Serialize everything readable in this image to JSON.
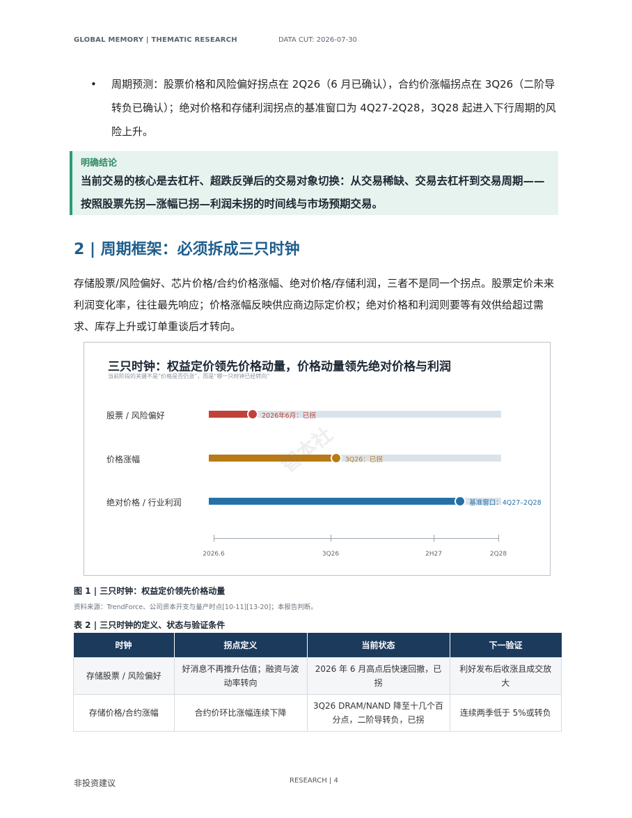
{
  "header": {
    "left": "GLOBAL MEMORY  |  THEMATIC RESEARCH",
    "right": "DATA CUT: 2026-07-30"
  },
  "bullet": {
    "symbol": "•",
    "text": "周期预测：股票价格和风险偏好拐点在 2Q26（6 月已确认），合约价涨幅拐点在 3Q26（二阶导转负已确认）；绝对价格和存储利润拐点的基准窗口为 4Q27-2Q28，3Q28 起进入下行周期的风险上升。"
  },
  "callout": {
    "label": "明确结论",
    "body": "当前交易的核心是去杠杆、超跌反弹后的交易对象切换：从交易稀缺、交易去杠杆到交易周期——按照股票先拐—涨幅已拐—利润未拐的时间线与市场预期交易。"
  },
  "section": {
    "title": "2 | 周期框架：必须拆成三只时钟",
    "paragraph": "存储股票/风险偏好、芯片价格/合约价格涨幅、绝对价格/存储利润，三者不是同一个拐点。股票定价未来利润变化率，往往最先响应；价格涨幅反映供应商边际定价权；绝对价格和利润则要等有效供给超过需求、库存上升或订单重谈后才转向。"
  },
  "chart_data": {
    "type": "bar",
    "title": "三只时钟：权益定价领先价格动量，价格动量领先绝对价格与利润",
    "subtitle": "当前阶段的关键不是“价格是否仍涨”，而是“哪一只时钟已经转向”",
    "x_ticks": [
      "2026.6",
      "3Q26",
      "2H27",
      "2Q28"
    ],
    "series": [
      {
        "name": "股票 / 风险偏好",
        "value": 0.15,
        "note": "2026年6月：已拐",
        "color": "#c0413a"
      },
      {
        "name": "价格涨幅",
        "value": 0.435,
        "note": "3Q26：已拐",
        "color": "#b87a16"
      },
      {
        "name": "绝对价格 / 行业利润",
        "value": 0.86,
        "note": "基准窗口：4Q27–2Q28",
        "color": "#2670a8"
      }
    ],
    "track_color": "#dbe3ea"
  },
  "watermark": "智本社",
  "figure": {
    "caption": "图 1 | 三只时钟：权益定价领先价格动量",
    "source": "资料来源：TrendForce、公司资本开支与量产时点[10-11][13-20]；本报告判断。"
  },
  "table": {
    "title": "表 2 | 三只时钟的定义、状态与验证条件",
    "headers": [
      "时钟",
      "拐点定义",
      "当前状态",
      "下一验证"
    ],
    "rows": [
      [
        "存储股票 / 风险偏好",
        "好消息不再推升估值；融资与波动率转向",
        "2026 年 6 月高点后快速回撤，已拐",
        "利好发布后收涨且成交放大"
      ],
      [
        "存储价格/合约涨幅",
        "合约价环比涨幅连续下降",
        "3Q26 DRAM/NAND 降至十几个百分点，二阶导转负，已拐",
        "连续两季低于 5%或转负"
      ]
    ]
  },
  "footer": {
    "left": "非投资建议",
    "center": "RESEARCH  |  4"
  }
}
